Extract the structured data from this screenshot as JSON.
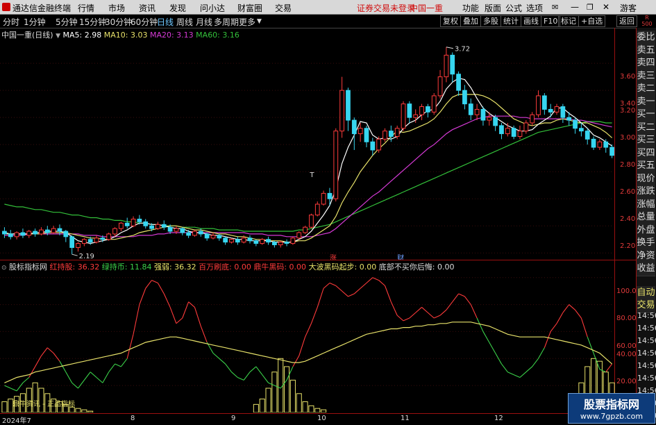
{
  "menu": {
    "app_title": "通达信金融终端",
    "items": [
      "行情",
      "市场",
      "资讯",
      "发现",
      "问小达",
      "财富圈",
      "交易"
    ],
    "login_status": "证券交易未登录",
    "broker": "中国一重",
    "right_items": [
      "功能",
      "版面",
      "公式",
      "选项"
    ],
    "guest": "游客"
  },
  "toolbar": {
    "periods": [
      "分时",
      "1分钟",
      "5分钟",
      "15分钟",
      "30分钟",
      "60分钟",
      "日线",
      "周线",
      "月线",
      "多周期",
      "更多"
    ],
    "active_period": "日线",
    "buttons": [
      "复权",
      "叠加",
      "多股",
      "统计",
      "画线",
      "F10",
      "标记",
      "+自选",
      "返回"
    ],
    "r_label": "R",
    "r_value": "500"
  },
  "main_chart": {
    "stock_title": "中国一重(日线)",
    "ma5": "MA5: 2.98",
    "ma10": "MA10: 3.03",
    "ma20": "MA20: 3.13",
    "ma60": "MA60: 3.16",
    "high_marker": "3.72",
    "low_marker": "2.19",
    "zhang_marker": "涨",
    "cai_marker": "财",
    "t_marker": "T"
  },
  "indicator": {
    "name": "股标指标网",
    "hong": "红持股: 36.32",
    "lv": "绿持币: 11.84",
    "qiang": "强弱: 36.32",
    "baiwan": "百万刷底: 0.00",
    "dingniu": "鼎牛黑码: 0.00",
    "dabo": "大波黑码起步: 0.00",
    "dibu": "底部不买你后悔: 0.00",
    "bottom_note": "鼎牛资讯 - 正品指标",
    "y_labels": [
      "100.0",
      "80.00",
      "60.00",
      "40.00",
      "20.00"
    ]
  },
  "date_axis": [
    "2024年7",
    "8",
    "9",
    "10",
    "11",
    "12"
  ],
  "right_panel": {
    "quote_items": [
      "委比",
      "卖五",
      "卖四",
      "卖三",
      "卖二",
      "卖一",
      "买一",
      "买二",
      "买三",
      "买四",
      "买五",
      "现价",
      "涨跌",
      "涨幅",
      "总量",
      "外盘",
      "换手",
      "净资",
      "收益"
    ],
    "lower_items": [
      "自动",
      "交易"
    ],
    "times": [
      "14:56",
      "14:56",
      "14:56",
      "14:56",
      "14:56",
      "14:56",
      "14:56",
      "14:56",
      "14:56"
    ]
  },
  "watermark": {
    "title": "股票指标网",
    "url": "www.7gpzb.com"
  },
  "colors": {
    "up": "#ff3b3b",
    "down": "#37d6f0",
    "ma5": "#ffffff",
    "ma10": "#e8e26a",
    "ma20": "#d63ad6",
    "ma60": "#33c13a"
  },
  "chart_data": {
    "type": "candlestick",
    "price_axis": [
      "3.60",
      "3.40",
      "3.20",
      "3.00",
      "2.80",
      "2.60",
      "2.40",
      "2.20"
    ],
    "ylim": [
      2.15,
      3.78
    ],
    "high": 3.72,
    "low": 2.19,
    "candles": [
      [
        2.36,
        2.34,
        2.39,
        2.31
      ],
      [
        2.34,
        2.32,
        2.37,
        2.3
      ],
      [
        2.32,
        2.35,
        2.36,
        2.3
      ],
      [
        2.35,
        2.33,
        2.38,
        2.31
      ],
      [
        2.33,
        2.36,
        2.37,
        2.31
      ],
      [
        2.36,
        2.34,
        2.38,
        2.32
      ],
      [
        2.34,
        2.37,
        2.39,
        2.33
      ],
      [
        2.37,
        2.35,
        2.4,
        2.33
      ],
      [
        2.35,
        2.38,
        2.4,
        2.34
      ],
      [
        2.38,
        2.36,
        2.41,
        2.33
      ],
      [
        2.36,
        2.32,
        2.37,
        2.28
      ],
      [
        2.32,
        2.24,
        2.33,
        2.19
      ],
      [
        2.24,
        2.27,
        2.28,
        2.21
      ],
      [
        2.27,
        2.3,
        2.31,
        2.25
      ],
      [
        2.3,
        2.28,
        2.32,
        2.26
      ],
      [
        2.28,
        2.31,
        2.33,
        2.27
      ],
      [
        2.31,
        2.3,
        2.33,
        2.28
      ],
      [
        2.3,
        2.34,
        2.35,
        2.29
      ],
      [
        2.34,
        2.38,
        2.39,
        2.32
      ],
      [
        2.38,
        2.42,
        2.43,
        2.36
      ],
      [
        2.42,
        2.4,
        2.46,
        2.38
      ],
      [
        2.4,
        2.45,
        2.47,
        2.39
      ],
      [
        2.45,
        2.43,
        2.48,
        2.41
      ],
      [
        2.43,
        2.4,
        2.45,
        2.38
      ],
      [
        2.4,
        2.38,
        2.42,
        2.36
      ],
      [
        2.38,
        2.41,
        2.43,
        2.37
      ],
      [
        2.41,
        2.39,
        2.44,
        2.37
      ],
      [
        2.39,
        2.36,
        2.41,
        2.34
      ],
      [
        2.36,
        2.38,
        2.4,
        2.34
      ],
      [
        2.38,
        2.35,
        2.39,
        2.33
      ],
      [
        2.35,
        2.33,
        2.37,
        2.31
      ],
      [
        2.33,
        2.36,
        2.37,
        2.32
      ],
      [
        2.36,
        2.34,
        2.38,
        2.32
      ],
      [
        2.34,
        2.31,
        2.35,
        2.29
      ],
      [
        2.31,
        2.33,
        2.35,
        2.3
      ],
      [
        2.33,
        2.31,
        2.34,
        2.29
      ],
      [
        2.31,
        2.28,
        2.32,
        2.26
      ],
      [
        2.28,
        2.3,
        2.31,
        2.27
      ],
      [
        2.3,
        2.28,
        2.32,
        2.26
      ],
      [
        2.28,
        2.31,
        2.33,
        2.27
      ],
      [
        2.31,
        2.29,
        2.33,
        2.27
      ],
      [
        2.29,
        2.27,
        2.3,
        2.25
      ],
      [
        2.27,
        2.3,
        2.31,
        2.26
      ],
      [
        2.3,
        2.28,
        2.32,
        2.26
      ],
      [
        2.28,
        2.26,
        2.29,
        2.24
      ],
      [
        2.26,
        2.28,
        2.29,
        2.24
      ],
      [
        2.28,
        2.27,
        2.3,
        2.25
      ],
      [
        2.27,
        2.31,
        2.32,
        2.26
      ],
      [
        2.31,
        2.35,
        2.36,
        2.3
      ],
      [
        2.35,
        2.39,
        2.4,
        2.34
      ],
      [
        2.39,
        2.48,
        2.49,
        2.38
      ],
      [
        2.48,
        2.56,
        2.58,
        2.47
      ],
      [
        2.56,
        2.64,
        2.66,
        2.55
      ],
      [
        2.64,
        2.6,
        2.68,
        2.55
      ],
      [
        2.6,
        3.1,
        3.12,
        2.58
      ],
      [
        3.1,
        3.4,
        3.5,
        3.05
      ],
      [
        3.4,
        3.18,
        3.42,
        3.1
      ],
      [
        3.18,
        3.08,
        3.2,
        2.96
      ],
      [
        3.08,
        3.12,
        3.16,
        3.02
      ],
      [
        3.12,
        3.02,
        3.14,
        2.98
      ],
      [
        3.02,
        2.96,
        3.05,
        2.92
      ],
      [
        2.96,
        3.04,
        3.06,
        2.94
      ],
      [
        3.04,
        3.1,
        3.12,
        3.02
      ],
      [
        3.1,
        3.06,
        3.14,
        3.02
      ],
      [
        3.06,
        3.12,
        3.14,
        3.04
      ],
      [
        3.12,
        3.3,
        3.32,
        3.1
      ],
      [
        3.3,
        3.2,
        3.32,
        3.16
      ],
      [
        3.2,
        3.22,
        3.26,
        3.16
      ],
      [
        3.22,
        3.28,
        3.3,
        3.18
      ],
      [
        3.28,
        3.24,
        3.3,
        3.2
      ],
      [
        3.24,
        3.36,
        3.38,
        3.22
      ],
      [
        3.36,
        3.5,
        3.55,
        3.34
      ],
      [
        3.5,
        3.66,
        3.72,
        3.46
      ],
      [
        3.66,
        3.52,
        3.68,
        3.46
      ],
      [
        3.52,
        3.4,
        3.54,
        3.36
      ],
      [
        3.4,
        3.3,
        3.44,
        3.26
      ],
      [
        3.3,
        3.22,
        3.34,
        3.18
      ],
      [
        3.22,
        3.26,
        3.3,
        3.18
      ],
      [
        3.26,
        3.18,
        3.28,
        3.14
      ],
      [
        3.18,
        3.2,
        3.24,
        3.14
      ],
      [
        3.2,
        3.14,
        3.22,
        3.1
      ],
      [
        3.14,
        3.08,
        3.16,
        3.04
      ],
      [
        3.08,
        3.12,
        3.16,
        3.06
      ],
      [
        3.12,
        3.06,
        3.14,
        3.04
      ],
      [
        3.06,
        3.1,
        3.14,
        3.04
      ],
      [
        3.1,
        3.16,
        3.18,
        3.08
      ],
      [
        3.16,
        3.22,
        3.24,
        3.14
      ],
      [
        3.22,
        3.36,
        3.4,
        3.2
      ],
      [
        3.36,
        3.26,
        3.38,
        3.22
      ],
      [
        3.26,
        3.24,
        3.3,
        3.2
      ],
      [
        3.24,
        3.28,
        3.3,
        3.22
      ],
      [
        3.28,
        3.2,
        3.3,
        3.16
      ],
      [
        3.2,
        3.18,
        3.24,
        3.14
      ],
      [
        3.18,
        3.12,
        3.2,
        3.08
      ],
      [
        3.12,
        3.1,
        3.16,
        3.06
      ],
      [
        3.1,
        3.04,
        3.12,
        3.0
      ],
      [
        3.04,
        2.98,
        3.06,
        2.96
      ],
      [
        2.98,
        3.02,
        3.04,
        2.96
      ],
      [
        3.02,
        2.98,
        3.04,
        2.94
      ],
      [
        2.98,
        2.92,
        3.0,
        2.9
      ]
    ],
    "ma5": [
      2.35,
      2.34,
      2.34,
      2.34,
      2.34,
      2.35,
      2.35,
      2.36,
      2.36,
      2.36,
      2.35,
      2.32,
      2.29,
      2.28,
      2.27,
      2.28,
      2.29,
      2.3,
      2.32,
      2.35,
      2.37,
      2.4,
      2.42,
      2.42,
      2.41,
      2.41,
      2.4,
      2.39,
      2.38,
      2.38,
      2.36,
      2.35,
      2.35,
      2.34,
      2.33,
      2.33,
      2.32,
      2.31,
      2.3,
      2.3,
      2.29,
      2.29,
      2.29,
      2.29,
      2.28,
      2.28,
      2.28,
      2.28,
      2.3,
      2.32,
      2.36,
      2.42,
      2.48,
      2.55,
      2.67,
      2.86,
      2.98,
      3.07,
      3.17,
      3.16,
      3.07,
      3.04,
      3.05,
      3.04,
      3.06,
      3.12,
      3.16,
      3.18,
      3.22,
      3.25,
      3.26,
      3.32,
      3.41,
      3.46,
      3.49,
      3.48,
      3.42,
      3.34,
      3.27,
      3.23,
      3.2,
      3.17,
      3.14,
      3.12,
      3.1,
      3.1,
      3.11,
      3.15,
      3.18,
      3.21,
      3.27,
      3.27,
      3.23,
      3.2,
      3.16,
      3.12,
      3.07,
      3.05,
      3.02,
      2.99
    ],
    "ma10": [
      2.34,
      2.34,
      2.34,
      2.34,
      2.34,
      2.34,
      2.34,
      2.35,
      2.35,
      2.35,
      2.35,
      2.34,
      2.33,
      2.32,
      2.31,
      2.31,
      2.3,
      2.3,
      2.3,
      2.31,
      2.32,
      2.33,
      2.35,
      2.36,
      2.37,
      2.38,
      2.39,
      2.4,
      2.4,
      2.39,
      2.38,
      2.37,
      2.37,
      2.36,
      2.35,
      2.34,
      2.34,
      2.33,
      2.32,
      2.32,
      2.31,
      2.3,
      2.3,
      2.29,
      2.29,
      2.29,
      2.28,
      2.28,
      2.29,
      2.29,
      2.31,
      2.34,
      2.37,
      2.4,
      2.47,
      2.57,
      2.65,
      2.72,
      2.8,
      2.86,
      2.92,
      2.97,
      3.01,
      3.06,
      3.1,
      3.09,
      3.1,
      3.12,
      3.14,
      3.16,
      3.19,
      3.24,
      3.3,
      3.35,
      3.37,
      3.37,
      3.37,
      3.37,
      3.36,
      3.34,
      3.31,
      3.27,
      3.23,
      3.19,
      3.17,
      3.15,
      3.14,
      3.15,
      3.16,
      3.16,
      3.18,
      3.19,
      3.18,
      3.17,
      3.16,
      3.16,
      3.14,
      3.12,
      3.09,
      3.05
    ],
    "ma20": [
      2.33,
      2.33,
      2.33,
      2.33,
      2.34,
      2.34,
      2.34,
      2.34,
      2.34,
      2.34,
      2.34,
      2.34,
      2.34,
      2.33,
      2.33,
      2.33,
      2.32,
      2.32,
      2.32,
      2.32,
      2.32,
      2.32,
      2.33,
      2.33,
      2.33,
      2.34,
      2.34,
      2.35,
      2.35,
      2.35,
      2.35,
      2.35,
      2.35,
      2.35,
      2.35,
      2.35,
      2.35,
      2.35,
      2.35,
      2.35,
      2.34,
      2.34,
      2.34,
      2.33,
      2.33,
      2.33,
      2.32,
      2.32,
      2.32,
      2.32,
      2.32,
      2.33,
      2.34,
      2.35,
      2.38,
      2.42,
      2.46,
      2.5,
      2.54,
      2.58,
      2.62,
      2.65,
      2.69,
      2.73,
      2.77,
      2.81,
      2.85,
      2.89,
      2.93,
      2.97,
      3.0,
      3.04,
      3.08,
      3.11,
      3.13,
      3.15,
      3.17,
      3.19,
      3.2,
      3.21,
      3.21,
      3.21,
      3.21,
      3.21,
      3.2,
      3.2,
      3.19,
      3.19,
      3.19,
      3.19,
      3.19,
      3.19,
      3.19,
      3.18,
      3.18,
      3.17,
      3.16,
      3.15,
      3.14,
      3.13
    ],
    "ma60": [
      2.56,
      2.55,
      2.54,
      2.54,
      2.53,
      2.52,
      2.52,
      2.51,
      2.5,
      2.5,
      2.49,
      2.48,
      2.48,
      2.47,
      2.46,
      2.46,
      2.45,
      2.45,
      2.44,
      2.44,
      2.43,
      2.43,
      2.42,
      2.42,
      2.41,
      2.41,
      2.4,
      2.4,
      2.4,
      2.39,
      2.39,
      2.39,
      2.38,
      2.38,
      2.38,
      2.37,
      2.37,
      2.37,
      2.37,
      2.36,
      2.36,
      2.36,
      2.36,
      2.36,
      2.36,
      2.36,
      2.36,
      2.36,
      2.37,
      2.37,
      2.38,
      2.39,
      2.4,
      2.41,
      2.43,
      2.45,
      2.47,
      2.49,
      2.51,
      2.53,
      2.55,
      2.57,
      2.59,
      2.61,
      2.63,
      2.65,
      2.67,
      2.69,
      2.71,
      2.73,
      2.75,
      2.77,
      2.79,
      2.81,
      2.83,
      2.85,
      2.87,
      2.89,
      2.91,
      2.93,
      2.95,
      2.97,
      2.99,
      3.01,
      3.03,
      3.05,
      3.07,
      3.09,
      3.1,
      3.11,
      3.12,
      3.13,
      3.14,
      3.15,
      3.16,
      3.17,
      3.17,
      3.17,
      3.16,
      3.16
    ],
    "indicator_ylim": [
      0,
      105
    ],
    "qiangruo": [
      20,
      18,
      16,
      22,
      26,
      34,
      42,
      48,
      44,
      38,
      30,
      22,
      18,
      24,
      30,
      26,
      22,
      30,
      36,
      34,
      40,
      58,
      80,
      92,
      98,
      96,
      88,
      78,
      66,
      70,
      82,
      78,
      64,
      52,
      44,
      40,
      36,
      30,
      26,
      24,
      30,
      34,
      28,
      22,
      20,
      18,
      24,
      34,
      42,
      56,
      66,
      78,
      92,
      96,
      94,
      90,
      86,
      88,
      92,
      96,
      100,
      98,
      94,
      82,
      72,
      68,
      70,
      74,
      78,
      74,
      70,
      72,
      76,
      82,
      88,
      86,
      80,
      70,
      60,
      52,
      44,
      36,
      30,
      28,
      26,
      30,
      34,
      40,
      48,
      60,
      66,
      74,
      80,
      76,
      70,
      56,
      44,
      32,
      30,
      36
    ],
    "trend": [
      22,
      24,
      26,
      27,
      28,
      30,
      31,
      32,
      33,
      34,
      35,
      36,
      37,
      38,
      39,
      40,
      41,
      42,
      43,
      44,
      46,
      48,
      50,
      52,
      53,
      54,
      55,
      56,
      56,
      55,
      54,
      53,
      52,
      51,
      50,
      49,
      48,
      47,
      46,
      45,
      44,
      43,
      42,
      41,
      40,
      39,
      38,
      37,
      37,
      38,
      40,
      42,
      44,
      46,
      48,
      50,
      52,
      54,
      56,
      58,
      59,
      60,
      61,
      62,
      62,
      63,
      63,
      64,
      64,
      65,
      65,
      66,
      66,
      67,
      67,
      67,
      67,
      66,
      65,
      64,
      62,
      60,
      58,
      57,
      56,
      56,
      56,
      56,
      56,
      55,
      54,
      53,
      52,
      51,
      50,
      48,
      46,
      44,
      40,
      36
    ],
    "bars_left": [
      8,
      10,
      12,
      14,
      18,
      22,
      18,
      14,
      10,
      8,
      6,
      4,
      3,
      2,
      1
    ],
    "bars_mid": [
      6,
      10,
      18,
      30,
      40,
      34,
      24,
      14,
      8,
      5,
      3,
      2
    ],
    "bars_right": [
      12,
      22,
      34,
      40,
      38,
      30,
      22
    ]
  }
}
